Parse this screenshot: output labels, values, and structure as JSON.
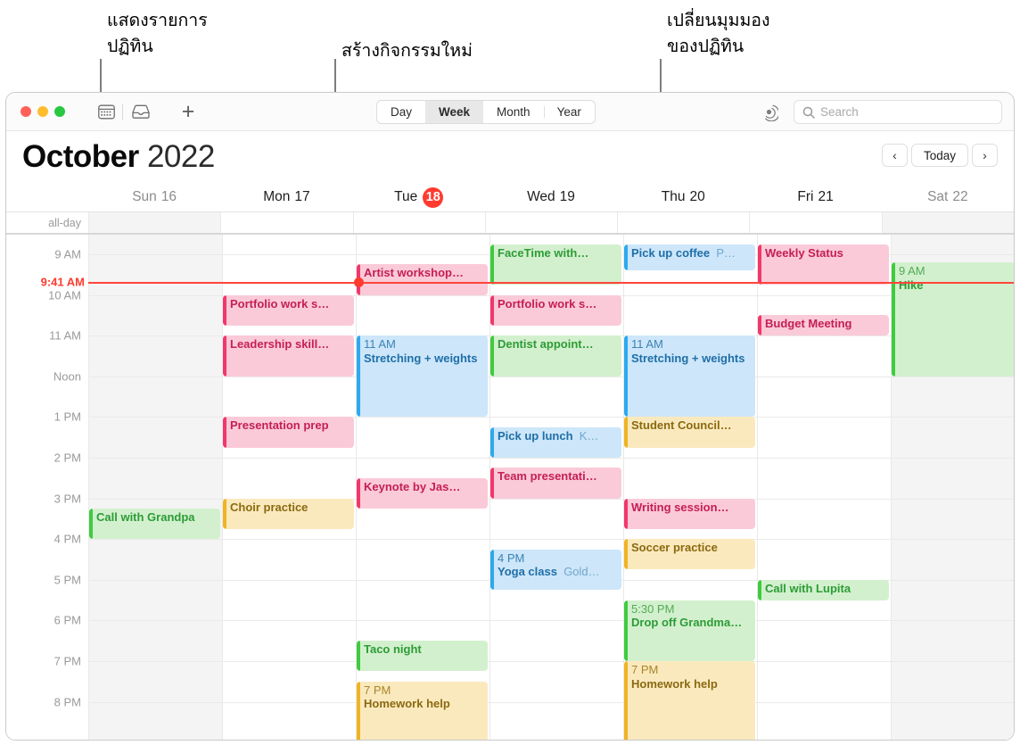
{
  "annotations": [
    {
      "id": "show-calendar-list",
      "text": "แสดงรายการ\nปฏิทิน"
    },
    {
      "id": "create-new-event",
      "text": "สร้างกิจกรรมใหม่"
    },
    {
      "id": "change-calendar-view",
      "text": "เปลี่ยนมุมมอง\nของปฏิทิน"
    }
  ],
  "toolbar": {
    "icons": {
      "calendar_list": "calendar-list-icon",
      "inbox": "inbox-icon",
      "new_event": "+",
      "availability": "availability-icon",
      "search": "search-icon"
    },
    "view_segments": [
      {
        "label": "Day",
        "active": false
      },
      {
        "label": "Week",
        "active": true
      },
      {
        "label": "Month",
        "active": false
      },
      {
        "label": "Year",
        "active": false
      }
    ],
    "search": {
      "value": "",
      "placeholder": "Search"
    }
  },
  "header": {
    "month": "October",
    "year": "2022",
    "nav": {
      "prev": "‹",
      "today": "Today",
      "next": "›"
    }
  },
  "days": [
    {
      "name": "Sun",
      "num": "16",
      "weekend": true,
      "today": false
    },
    {
      "name": "Mon",
      "num": "17",
      "weekend": false,
      "today": false
    },
    {
      "name": "Tue",
      "num": "18",
      "weekend": false,
      "today": true
    },
    {
      "name": "Wed",
      "num": "19",
      "weekend": false,
      "today": false
    },
    {
      "name": "Thu",
      "num": "20",
      "weekend": false,
      "today": false
    },
    {
      "name": "Fri",
      "num": "21",
      "weekend": false,
      "today": false
    },
    {
      "name": "Sat",
      "num": "22",
      "weekend": true,
      "today": false
    }
  ],
  "all_day_label": "all-day",
  "time_labels": [
    "9 AM",
    "10 AM",
    "11 AM",
    "Noon",
    "1 PM",
    "2 PM",
    "3 PM",
    "4 PM",
    "5 PM",
    "6 PM",
    "7 PM",
    "8 PM"
  ],
  "now_indicator": {
    "label": "9:41 AM",
    "day_index": 2
  },
  "events": [
    {
      "day": 0,
      "title": "Call with Grandpa",
      "time": "",
      "location": "",
      "color": "green",
      "start": 15.25,
      "end": 16.0,
      "oneline": true
    },
    {
      "day": 1,
      "title": "Portfolio work s…",
      "time": "",
      "location": "",
      "color": "pink",
      "start": 10.0,
      "end": 10.75,
      "oneline": true
    },
    {
      "day": 1,
      "title": "Leadership skill…",
      "time": "",
      "location": "",
      "color": "pink",
      "start": 11.0,
      "end": 12.0,
      "oneline": true
    },
    {
      "day": 1,
      "title": "Presentation prep",
      "time": "",
      "location": "",
      "color": "pink",
      "start": 13.0,
      "end": 13.75,
      "oneline": true
    },
    {
      "day": 1,
      "title": "Choir practice",
      "time": "",
      "location": "",
      "color": "yellow",
      "start": 15.0,
      "end": 15.75,
      "oneline": true
    },
    {
      "day": 2,
      "title": "Artist workshop…",
      "time": "",
      "location": "",
      "color": "pink",
      "start": 9.25,
      "end": 10.0,
      "oneline": true
    },
    {
      "day": 2,
      "title": "Stretching + weights",
      "time": "11 AM",
      "location": "",
      "color": "blue",
      "start": 11.0,
      "end": 13.0,
      "oneline": false
    },
    {
      "day": 2,
      "title": "Keynote by Jas…",
      "time": "",
      "location": "",
      "color": "pink",
      "start": 14.5,
      "end": 15.25,
      "oneline": true
    },
    {
      "day": 2,
      "title": "Taco night",
      "time": "",
      "location": "",
      "color": "green",
      "start": 18.5,
      "end": 19.25,
      "oneline": true
    },
    {
      "day": 2,
      "title": "Homework help",
      "time": "7 PM",
      "location": "",
      "color": "yellow",
      "start": 19.5,
      "end": 21.0,
      "oneline": false
    },
    {
      "day": 3,
      "title": "FaceTime with…",
      "time": "",
      "location": "",
      "color": "green",
      "start": 8.75,
      "end": 9.75,
      "oneline": true
    },
    {
      "day": 3,
      "title": "Portfolio work s…",
      "time": "",
      "location": "",
      "color": "pink",
      "start": 10.0,
      "end": 10.75,
      "oneline": true
    },
    {
      "day": 3,
      "title": "Dentist appoint…",
      "time": "",
      "location": "",
      "color": "green",
      "start": 11.0,
      "end": 12.0,
      "oneline": true
    },
    {
      "day": 3,
      "title": "Pick up lunch",
      "time": "",
      "location": "K…",
      "color": "blue",
      "start": 13.25,
      "end": 14.0,
      "oneline": true
    },
    {
      "day": 3,
      "title": "Team presentati…",
      "time": "",
      "location": "",
      "color": "pink",
      "start": 14.25,
      "end": 15.0,
      "oneline": true
    },
    {
      "day": 3,
      "title": "Yoga class",
      "time": "4 PM",
      "location": "Gold…",
      "color": "blue",
      "start": 16.25,
      "end": 17.25,
      "oneline": false
    },
    {
      "day": 4,
      "title": "Pick up coffee",
      "time": "",
      "location": "P…",
      "color": "blue",
      "start": 8.75,
      "end": 9.4,
      "oneline": true
    },
    {
      "day": 4,
      "title": "Stretching + weights",
      "time": "11 AM",
      "location": "",
      "color": "blue",
      "start": 11.0,
      "end": 13.0,
      "oneline": false
    },
    {
      "day": 4,
      "title": "Student Council…",
      "time": "",
      "location": "",
      "color": "yellow",
      "start": 13.0,
      "end": 13.75,
      "oneline": true
    },
    {
      "day": 4,
      "title": "Writing session…",
      "time": "",
      "location": "",
      "color": "pink",
      "start": 15.0,
      "end": 15.75,
      "oneline": true
    },
    {
      "day": 4,
      "title": "Soccer practice",
      "time": "",
      "location": "",
      "color": "yellow",
      "start": 16.0,
      "end": 16.75,
      "oneline": true
    },
    {
      "day": 4,
      "title": "Drop off Grandma…",
      "time": "5:30 PM",
      "location": "",
      "color": "green",
      "start": 17.5,
      "end": 19.0,
      "oneline": false
    },
    {
      "day": 4,
      "title": "Homework help",
      "time": "7 PM",
      "location": "",
      "color": "yellow",
      "start": 19.0,
      "end": 21.0,
      "oneline": false
    },
    {
      "day": 5,
      "title": "Weekly Status",
      "time": "",
      "location": "",
      "color": "pink",
      "start": 8.75,
      "end": 9.75,
      "oneline": true
    },
    {
      "day": 5,
      "title": "Budget Meeting",
      "time": "",
      "location": "",
      "color": "pink",
      "start": 10.5,
      "end": 11.0,
      "oneline": true
    },
    {
      "day": 5,
      "title": "Call with Lupita",
      "time": "",
      "location": "",
      "color": "green",
      "start": 17.0,
      "end": 17.5,
      "oneline": true
    },
    {
      "day": 6,
      "title": "Hike",
      "time": "9 AM",
      "location": "",
      "color": "green",
      "start": 9.2,
      "end": 12.0,
      "oneline": false
    }
  ],
  "colors": {
    "pink_fill": "#facad8",
    "pink_bar": "#f2376b",
    "pink_text": "#c51e56",
    "green_fill": "#d3f0ce",
    "green_bar": "#3fcb3f",
    "green_text": "#2c9c36",
    "blue_fill": "#cde6f9",
    "blue_bar": "#2da9ee",
    "blue_text": "#1f6fa8",
    "yellow_fill": "#fbe9be",
    "yellow_bar": "#f0b323",
    "yellow_text": "#8a6a10",
    "now_red": "#ff3b30",
    "today_badge": "#ff3b30"
  }
}
